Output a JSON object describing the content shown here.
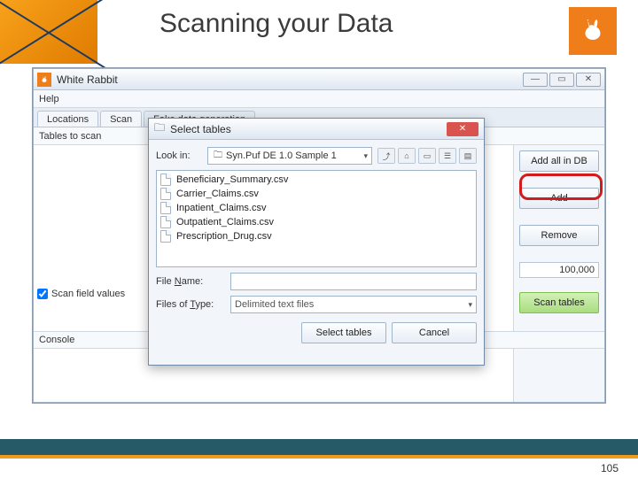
{
  "slide": {
    "title": "Scanning your Data",
    "page_number": "105"
  },
  "app": {
    "title": "White Rabbit",
    "menu_help": "Help",
    "tabs": {
      "locations": "Locations",
      "scan": "Scan",
      "fake": "Fake data generation"
    },
    "tables_to_scan": "Tables to scan",
    "scan_field_values": "Scan field values",
    "sample_value": "100,000",
    "console": "Console",
    "buttons": {
      "add_all": "Add all in DB",
      "add": "Add",
      "remove": "Remove",
      "scan_tables": "Scan tables"
    }
  },
  "dialog": {
    "title": "Select tables",
    "look_in_label": "Look in:",
    "look_in_value": "Syn.Puf DE 1.0 Sample 1",
    "files": [
      "Beneficiary_Summary.csv",
      "Carrier_Claims.csv",
      "Inpatient_Claims.csv",
      "Outpatient_Claims.csv",
      "Prescription_Drug.csv"
    ],
    "file_name_label": "File Name:",
    "file_name_value": "",
    "files_of_type_label": "Files of Type:",
    "files_of_type_value": "Delimited text files",
    "select_btn": "Select tables",
    "cancel_btn": "Cancel"
  }
}
